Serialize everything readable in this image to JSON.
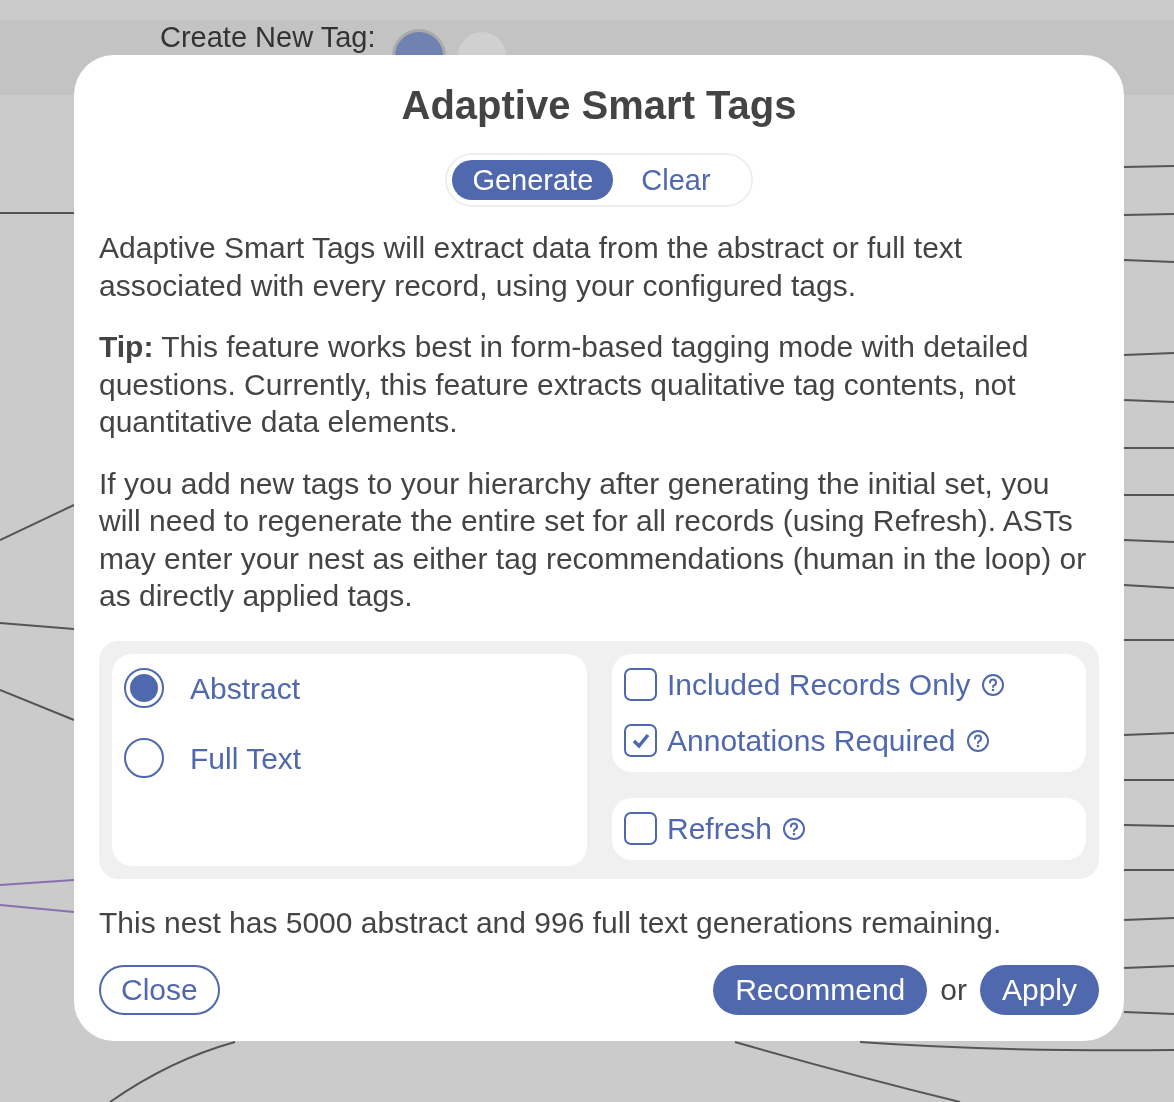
{
  "background": {
    "toolbar_label": "Create New Tag:"
  },
  "dialog": {
    "title": "Adaptive Smart Tags",
    "mode_tabs": [
      {
        "label": "Generate",
        "selected": true
      },
      {
        "label": "Clear",
        "selected": false
      }
    ],
    "paragraphs": [
      "Adaptive Smart Tags will extract data from the abstract or full text associated with every record, using your configured tags.",
      "**Tip:** This feature works best in form-based tagging mode with detailed questions. Currently, this feature extracts qualitative tag contents, not quantitative data elements.",
      "If you add new tags to your hierarchy after generating the initial set, you will need to regenerate the entire set for all records (using Refresh). ASTs may enter your nest as either tag recommendations (human in the loop) or as directly applied tags."
    ],
    "sources": [
      {
        "label": "Abstract",
        "selected": true
      },
      {
        "label": "Full Text",
        "selected": false
      }
    ],
    "option_groups": [
      {
        "options": [
          {
            "label": "Included Records Only",
            "checked": false
          },
          {
            "label": "Annotations Required",
            "checked": true
          }
        ]
      },
      {
        "options": [
          {
            "label": "Refresh",
            "checked": false
          }
        ]
      }
    ],
    "remaining": "This nest has 5000 abstract and 996 full text generations remaining.",
    "close_button": "Close",
    "recommend_button": "Recommend",
    "or_text": "or",
    "apply_button": "Apply"
  }
}
